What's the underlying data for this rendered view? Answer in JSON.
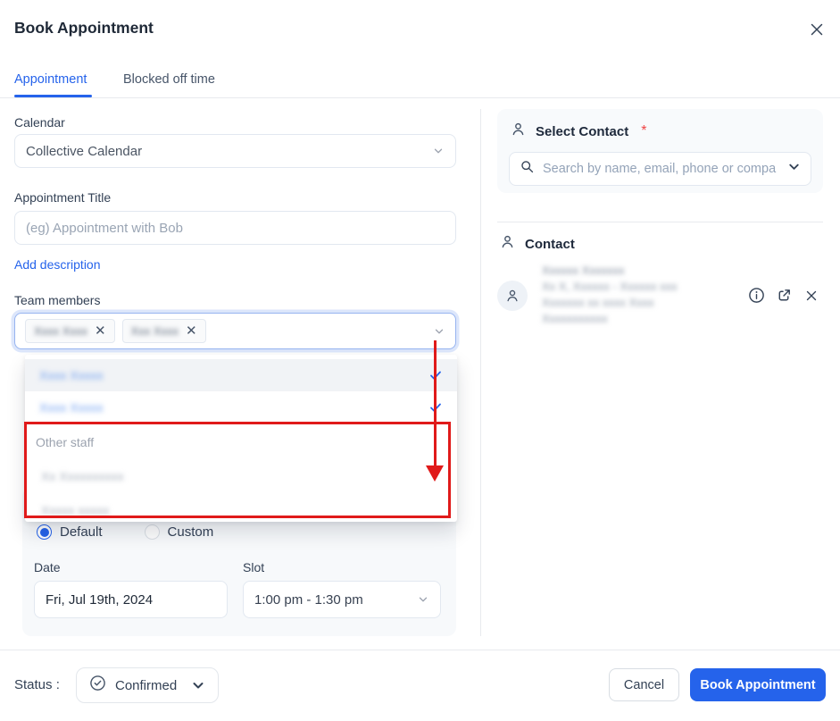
{
  "modal": {
    "title": "Book Appointment"
  },
  "tabs": {
    "appointment": "Appointment",
    "blocked": "Blocked off time"
  },
  "form": {
    "calendar": {
      "label": "Calendar",
      "value": "Collective Calendar"
    },
    "title": {
      "label": "Appointment Title",
      "placeholder": "(eg) Appointment with Bob"
    },
    "add_description": "Add description",
    "team_members": {
      "label": "Team members",
      "chips": [
        "Xxxx Xxxx",
        "Xxx Xxxx"
      ]
    },
    "dropdown": {
      "selected": [
        "Xxxx Xxxxx",
        "Xxxx Xxxxx"
      ],
      "group_label": "Other staff",
      "others": [
        "Xx Xxxxxxxxxx",
        "Xxxxx xxxxx"
      ]
    },
    "schedule": {
      "default_label": "Default",
      "custom_label": "Custom",
      "date_label": "Date",
      "date_value": "Fri, Jul 19th, 2024",
      "slot_label": "Slot",
      "slot_value": "1:00 pm - 1:30 pm"
    }
  },
  "contact": {
    "select_label": "Select Contact",
    "required_mark": "*",
    "search_placeholder": "Search by name, email, phone or compa",
    "section_label": "Contact",
    "card_lines": [
      "Xxxxxx Xxxxxxx",
      "Xx X, Xxxxxx - Xxxxxx xxx",
      "Xxxxxxx xx xxxx Xxxx",
      "Xxxxxxxxxxx"
    ]
  },
  "footer": {
    "status_label": "Status :",
    "status_value": "Confirmed",
    "cancel": "Cancel",
    "submit": "Book Appointment"
  },
  "colors": {
    "accent_blue": "#2563eb",
    "annotation_red": "#e01a1a",
    "required_red": "#ef4444"
  }
}
